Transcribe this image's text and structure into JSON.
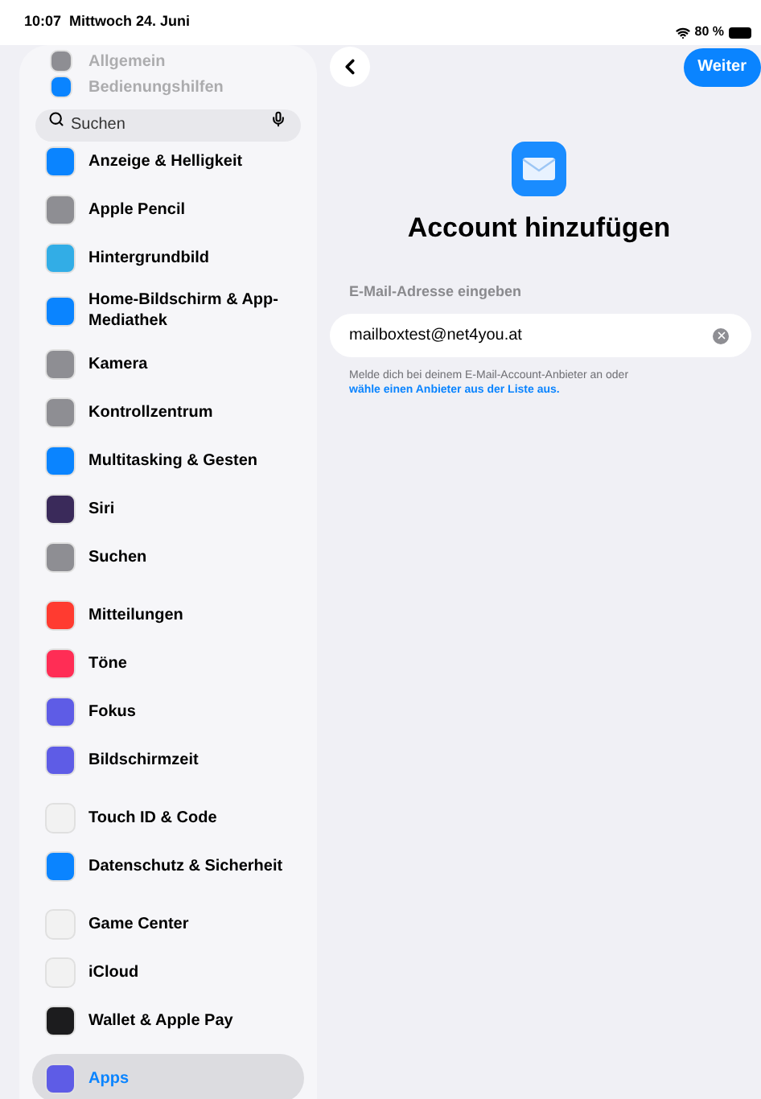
{
  "status_bar": {
    "time": "10:07",
    "date": "Mittwoch 24. Juni",
    "battery": "80 %"
  },
  "sidebar": {
    "search": {
      "placeholder": "Suchen"
    },
    "groups": [
      {
        "items": [
          {
            "label": "Allgemein",
            "color": "#8e8e93",
            "faded": true,
            "selected": false
          },
          {
            "label": "Bedienungshilfen",
            "color": "#0a84ff",
            "faded": true,
            "selected": false
          }
        ]
      },
      {
        "items": [
          {
            "label": "Anzeige & Helligkeit",
            "color": "#0a84ff",
            "faded": false,
            "selected": false
          },
          {
            "label": "Apple Pencil",
            "color": "#8e8e93",
            "faded": false,
            "selected": false
          },
          {
            "label": "Hintergrundbild",
            "color": "#32ade6",
            "faded": false,
            "selected": false
          },
          {
            "label": "Home-Bildschirm & App-Mediathek",
            "color": "#0a84ff",
            "faded": false,
            "selected": false
          },
          {
            "label": "Kamera",
            "color": "#8e8e93",
            "faded": false,
            "selected": false
          },
          {
            "label": "Kontrollzentrum",
            "color": "#8e8e93",
            "faded": false,
            "selected": false
          },
          {
            "label": "Multitasking & Gesten",
            "color": "#0a84ff",
            "faded": false,
            "selected": false
          },
          {
            "label": "Siri",
            "color": "#3a2a5a",
            "faded": false,
            "selected": false
          },
          {
            "label": "Suchen",
            "color": "#8e8e93",
            "faded": false,
            "selected": false
          }
        ]
      },
      {
        "items": [
          {
            "label": "Mitteilungen",
            "color": "#ff3b30",
            "faded": false,
            "selected": false
          },
          {
            "label": "Töne",
            "color": "#ff2d55",
            "faded": false,
            "selected": false
          },
          {
            "label": "Fokus",
            "color": "#5e5ce6",
            "faded": false,
            "selected": false
          },
          {
            "label": "Bildschirmzeit",
            "color": "#5e5ce6",
            "faded": false,
            "selected": false
          }
        ]
      },
      {
        "items": [
          {
            "label": "Touch ID & Code",
            "color": "#f2f2f2",
            "faded": false,
            "selected": false
          },
          {
            "label": "Datenschutz & Sicherheit",
            "color": "#0a84ff",
            "faded": false,
            "selected": false
          }
        ]
      },
      {
        "items": [
          {
            "label": "Game Center",
            "color": "#f2f2f2",
            "faded": false,
            "selected": false
          },
          {
            "label": "iCloud",
            "color": "#f2f2f2",
            "faded": false,
            "selected": false
          },
          {
            "label": "Wallet & Apple Pay",
            "color": "#1c1c1e",
            "faded": false,
            "selected": false
          }
        ]
      },
      {
        "items": [
          {
            "label": "Apps",
            "color": "#5e5ce6",
            "faded": false,
            "selected": true
          }
        ]
      }
    ]
  },
  "header": {
    "next_button": "Weiter"
  },
  "title": "Account hinzufügen",
  "email": {
    "label": "E-Mail-Adresse eingeben",
    "value": "mailboxtest@net4you.at"
  },
  "hint": {
    "text": "Melde dich bei deinem E-Mail-Account-Anbieter an oder",
    "link": "wähle einen Anbieter aus der Liste aus."
  }
}
